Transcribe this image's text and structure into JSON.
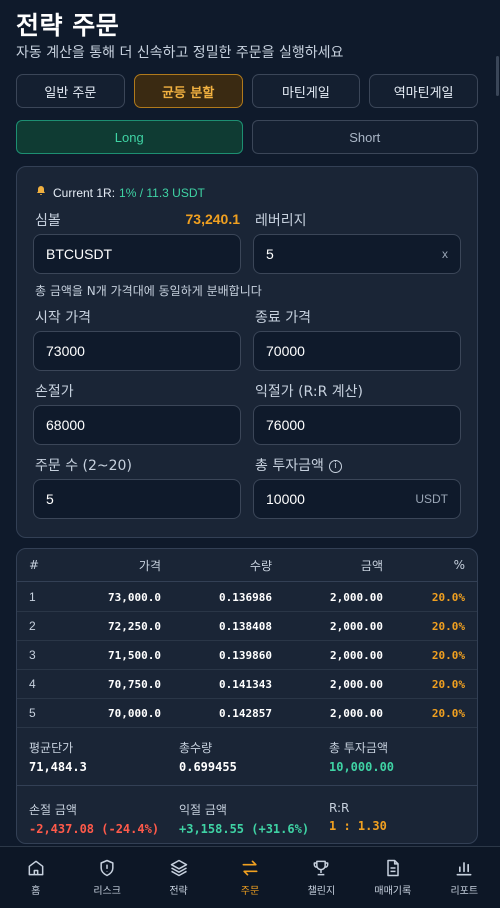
{
  "header": {
    "title": "전략 주문",
    "subtitle": "자동 계산을 통해 더 신속하고 정밀한 주문을 실행하세요"
  },
  "mode_tabs": [
    {
      "label": "일반 주문",
      "active": false
    },
    {
      "label": "균등 분할",
      "active": true
    },
    {
      "label": "마틴게일",
      "active": false
    },
    {
      "label": "역마틴게일",
      "active": false
    }
  ],
  "side_tabs": [
    {
      "label": "Long",
      "active": true
    },
    {
      "label": "Short",
      "active": false
    }
  ],
  "form": {
    "info_prefix": "Current 1R:",
    "info_value": "1% / 11.3 USDT",
    "symbol_label": "심볼",
    "symbol_price": "73,240.1",
    "symbol_value": "BTCUSDT",
    "leverage_label": "레버리지",
    "leverage_value": "5",
    "leverage_unit": "x",
    "note": "총 금액을 N개 가격대에 동일하게 분배합니다",
    "start_label": "시작 가격",
    "start_value": "73000",
    "end_label": "종료 가격",
    "end_value": "70000",
    "stop_label": "손절가",
    "stop_value": "68000",
    "take_label": "익절가 (R:R 계산)",
    "take_value": "76000",
    "count_label": "주문 수 (2~20)",
    "count_value": "5",
    "total_label": "총 투자금액",
    "total_value": "10000",
    "total_unit": "USDT"
  },
  "table": {
    "headers": [
      "#",
      "가격",
      "수량",
      "금액",
      "%"
    ],
    "rows": [
      [
        "1",
        "73,000.0",
        "0.136986",
        "2,000.00",
        "20.0%"
      ],
      [
        "2",
        "72,250.0",
        "0.138408",
        "2,000.00",
        "20.0%"
      ],
      [
        "3",
        "71,500.0",
        "0.139860",
        "2,000.00",
        "20.0%"
      ],
      [
        "4",
        "70,750.0",
        "0.141343",
        "2,000.00",
        "20.0%"
      ],
      [
        "5",
        "70,000.0",
        "0.142857",
        "2,000.00",
        "20.0%"
      ]
    ]
  },
  "summary": {
    "avg_label": "평균단가",
    "avg_value": "71,484.3",
    "qty_label": "총수량",
    "qty_value": "0.699455",
    "total_label": "총 투자금액",
    "total_value": "10,000.00",
    "loss_label": "손절 금액",
    "loss_value": "-2,437.08 (-24.4%)",
    "profit_label": "익절 금액",
    "profit_value": "+3,158.55 (+31.6%)",
    "rr_label": "R:R",
    "rr_value": "1 : 1.30"
  },
  "colors": {
    "accent_orange": "#f0a020",
    "accent_green": "#3fd3a4",
    "loss_red": "#ff5a4a",
    "background": "#0f1a2b"
  },
  "nav": [
    {
      "label": "홈",
      "icon": "home-icon",
      "active": false
    },
    {
      "label": "리스크",
      "icon": "shield-alert-icon",
      "active": false
    },
    {
      "label": "전략",
      "icon": "layers-icon",
      "active": false
    },
    {
      "label": "주문",
      "icon": "swap-arrows-icon",
      "active": true
    },
    {
      "label": "챌린지",
      "icon": "trophy-icon",
      "active": false
    },
    {
      "label": "매매기록",
      "icon": "document-icon",
      "active": false
    },
    {
      "label": "리포트",
      "icon": "bar-chart-icon",
      "active": false
    }
  ]
}
